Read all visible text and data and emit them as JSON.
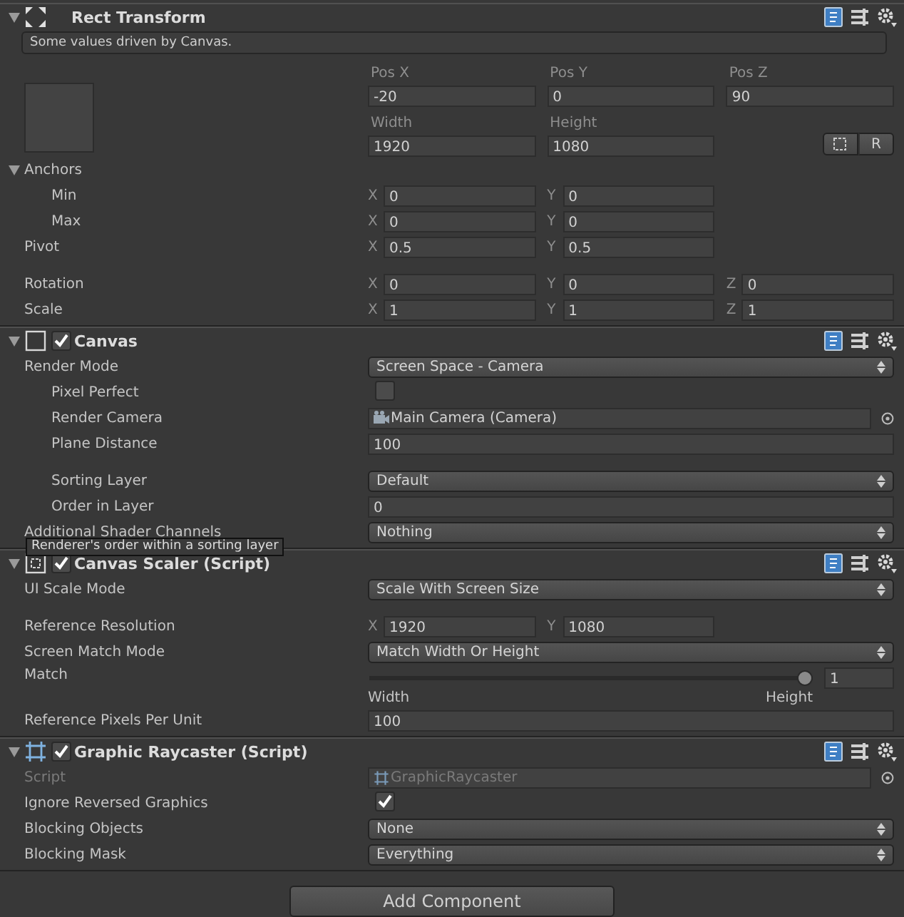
{
  "components": [
    {
      "kind": "rect_transform",
      "title": "Rect Transform",
      "expanded": true,
      "driven": true,
      "note": "Some values driven by Canvas.",
      "grid": [
        {
          "label": "Pos X",
          "value": "-20"
        },
        {
          "label": "Pos Y",
          "value": "0"
        },
        {
          "label": "Pos Z",
          "value": "90"
        },
        {
          "label": "Width",
          "value": "1920"
        },
        {
          "label": "Height",
          "value": "1080"
        }
      ],
      "raw_button": "R",
      "rows": [
        {
          "kind": "foldout",
          "label": "Anchors",
          "expanded": true,
          "children": [
            {
              "kind": "vector",
              "label": "Min",
              "fields": [
                {
                  "axis": "X",
                  "value": "0"
                },
                {
                  "axis": "Y",
                  "value": "0"
                }
              ]
            },
            {
              "kind": "vector",
              "label": "Max",
              "fields": [
                {
                  "axis": "X",
                  "value": "0"
                },
                {
                  "axis": "Y",
                  "value": "0"
                }
              ]
            }
          ]
        },
        {
          "kind": "vector",
          "label": "Pivot",
          "fields": [
            {
              "axis": "X",
              "value": "0.5"
            },
            {
              "axis": "Y",
              "value": "0.5"
            }
          ]
        },
        {
          "kind": "vector",
          "label": "Rotation",
          "gap_before": true,
          "fields": [
            {
              "axis": "X",
              "value": "0"
            },
            {
              "axis": "Y",
              "value": "0"
            },
            {
              "axis": "Z",
              "value": "0"
            }
          ]
        },
        {
          "kind": "vector",
          "label": "Scale",
          "fields": [
            {
              "axis": "X",
              "value": "1"
            },
            {
              "axis": "Y",
              "value": "1"
            },
            {
              "axis": "Z",
              "value": "1"
            }
          ]
        }
      ]
    },
    {
      "kind": "canvas",
      "title": "Canvas",
      "expanded": true,
      "enabled": true,
      "rows": [
        {
          "kind": "dropdown",
          "label": "Render Mode",
          "value": "Screen Space - Camera",
          "children": [
            {
              "kind": "checkbox",
              "label": "Pixel Perfect",
              "checked": false
            },
            {
              "kind": "object",
              "label": "Render Camera",
              "value": "Main Camera (Camera)"
            },
            {
              "kind": "number",
              "label": "Plane Distance",
              "value": "100"
            },
            {
              "kind": "dropdown",
              "label": "Sorting Layer",
              "value": "Default",
              "gap_before": true
            },
            {
              "kind": "number",
              "label": "Order in Layer",
              "value": "0",
              "tooltip": "Renderer's order within a sorting layer"
            }
          ]
        },
        {
          "kind": "dropdown",
          "label": "Additional Shader Channels",
          "value": "Nothing"
        }
      ]
    },
    {
      "kind": "canvas_scaler",
      "title": "Canvas Scaler (Script)",
      "expanded": true,
      "enabled": true,
      "rows": [
        {
          "kind": "dropdown",
          "label": "UI Scale Mode",
          "value": "Scale With Screen Size"
        },
        {
          "kind": "vector",
          "label": "Reference Resolution",
          "gap_before": true,
          "fields": [
            {
              "axis": "X",
              "value": "1920"
            },
            {
              "axis": "Y",
              "value": "1080"
            }
          ]
        },
        {
          "kind": "dropdown",
          "label": "Screen Match Mode",
          "value": "Match Width Or Height"
        },
        {
          "kind": "slider",
          "label": "Match",
          "level": 1,
          "value": "1",
          "min_label": "Width",
          "max_label": "Height"
        },
        {
          "kind": "number",
          "label": "Reference Pixels Per Unit",
          "value": "100"
        }
      ]
    },
    {
      "kind": "graphic_raycaster",
      "title": "Graphic Raycaster (Script)",
      "expanded": true,
      "enabled": true,
      "rows": [
        {
          "kind": "object",
          "label": "Script",
          "value": "GraphicRaycaster",
          "disabled": true
        },
        {
          "kind": "checkbox",
          "label": "Ignore Reversed Graphics",
          "checked": true,
          "disabled": false
        },
        {
          "kind": "dropdown",
          "label": "Blocking Objects",
          "value": "None",
          "disabled": false
        },
        {
          "kind": "dropdown",
          "label": "Blocking Mask",
          "value": "Everything",
          "disabled": false
        }
      ]
    }
  ],
  "add_button": "Add Component"
}
